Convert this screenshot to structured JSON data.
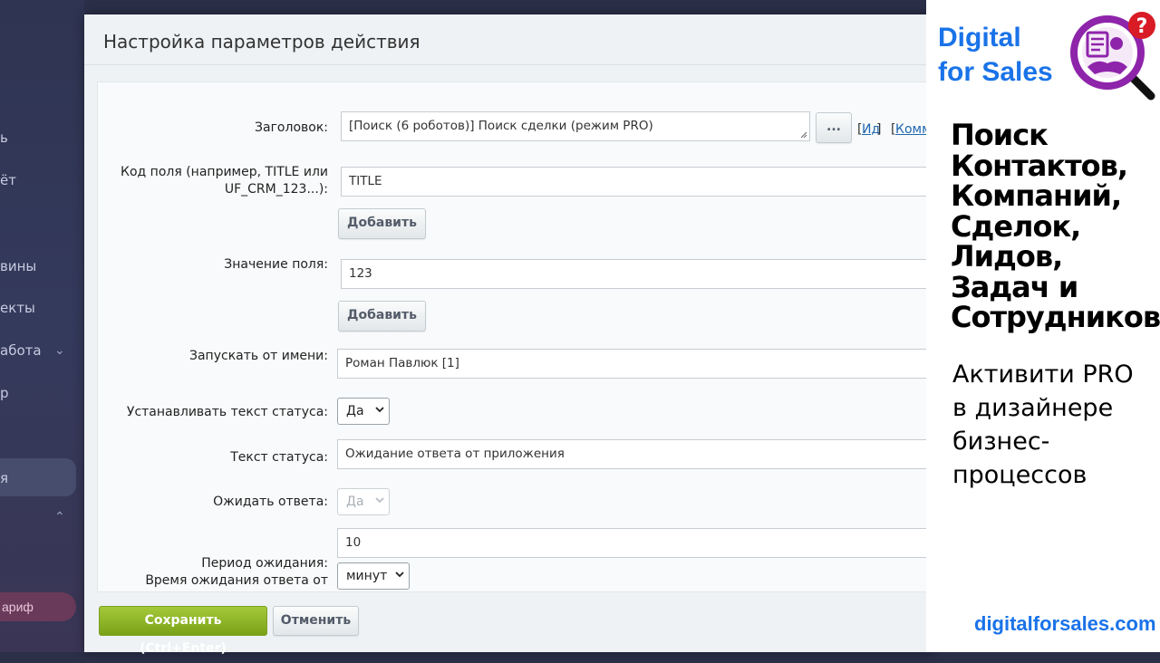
{
  "background_sidebar": {
    "items": [
      "ь",
      "ёт",
      "вины",
      "екты",
      "абота",
      "р",
      "я"
    ],
    "tariff_label": "ариф"
  },
  "dialog": {
    "title": "Настройка параметров действия",
    "fields": {
      "title_label": "Заголовок:",
      "title_value": "[Поиск (6 роботов)] Поиск сделки (режим PRO)",
      "dots_button": "...",
      "link_id": "Ид",
      "link_comment": "Комм",
      "field_code_label_1": "Код поля (например, TITLE или",
      "field_code_label_2": "UF_CRM_123...):",
      "field_code_value": "TITLE",
      "add_button_1": "Добавить",
      "field_value_label": "Значение поля:",
      "field_value_value": "123",
      "add_button_2": "Добавить",
      "run_as_label": "Запускать от имени:",
      "run_as_value": "Роман Павлюк [1]",
      "set_status_label": "Устанавливать текст статуса:",
      "set_status_value": "Да",
      "status_text_label": "Текст статуса:",
      "status_text_value": "Ожидание ответа от приложения",
      "wait_answer_label": "Ожидать ответа:",
      "wait_answer_value": "Да",
      "wait_period_value": "10",
      "wait_period_label": "Период ожидания:",
      "wait_time_label": "Время ожидания ответа от",
      "wait_unit_value": "минут"
    },
    "save_button": "Сохранить (Ctrl+Enter)",
    "cancel_button": "Отменить"
  },
  "promo": {
    "brand_line1": "Digital",
    "brand_line2": "for Sales",
    "heading": [
      "Поиск",
      "Контактов,",
      "Компаний,",
      "Сделок,",
      "Лидов,",
      "Задач и",
      "Сотрудников"
    ],
    "sub": [
      "Активити PRO",
      "в дизайнере",
      "бизнес-",
      "процессов"
    ],
    "url": "digitalforsales.com"
  },
  "colors": {
    "accent_green": "#8ab42a",
    "brand_blue": "#1a73e8",
    "logo_purple": "#8e24aa",
    "logo_red": "#d81b24"
  }
}
